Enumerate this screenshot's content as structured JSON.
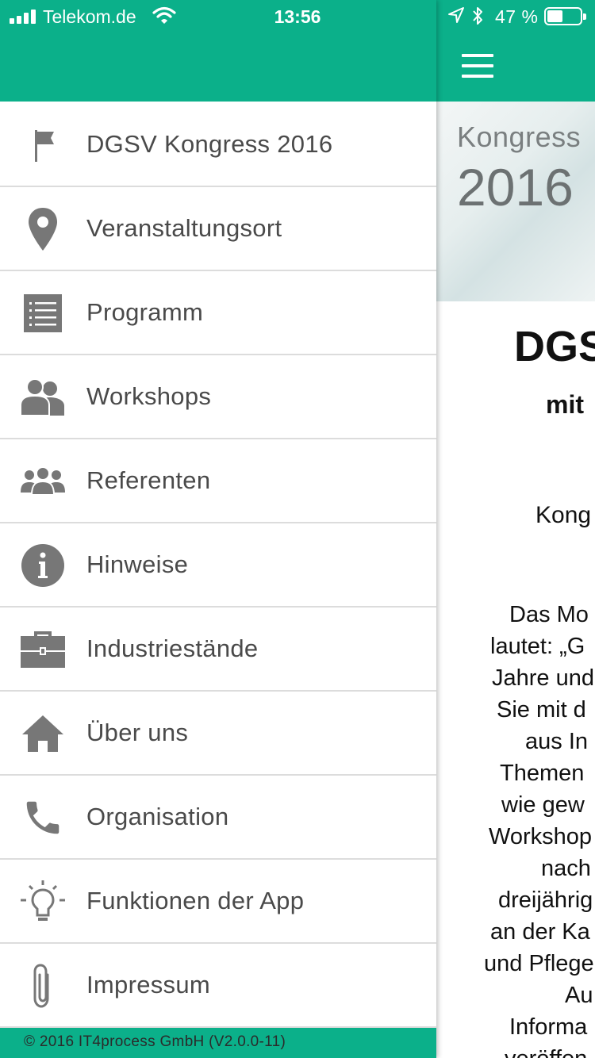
{
  "status_bar": {
    "carrier": "Telekom.de",
    "time": "13:56",
    "battery_percent": "47 %",
    "battery_level": 0.47
  },
  "colors": {
    "brand": "#0bb08a",
    "menu_text": "#4a4a4a",
    "icon": "#777777"
  },
  "drawer": {
    "items": [
      {
        "label": "DGSV Kongress 2016",
        "icon": "flag-icon"
      },
      {
        "label": "Veranstaltungsort",
        "icon": "map-pin-icon"
      },
      {
        "label": "Programm",
        "icon": "list-icon"
      },
      {
        "label": "Workshops",
        "icon": "people-pair-icon"
      },
      {
        "label": "Referenten",
        "icon": "group-icon"
      },
      {
        "label": "Hinweise",
        "icon": "info-icon"
      },
      {
        "label": "Industriestände",
        "icon": "briefcase-icon"
      },
      {
        "label": "Über uns",
        "icon": "home-icon"
      },
      {
        "label": "Organisation",
        "icon": "phone-icon"
      },
      {
        "label": "Funktionen der App",
        "icon": "lightbulb-icon"
      },
      {
        "label": "Impressum",
        "icon": "paperclip-icon"
      }
    ],
    "footer": "© 2016 IT4process GmbH (V2.0.0-11)"
  },
  "content": {
    "banner_line1": "Kongress",
    "banner_line2": "2016",
    "heading": "DGS",
    "subheading": "mit",
    "kong_line": "Kong",
    "paragraph_lines": [
      "Das Mo",
      "lautet: „G",
      "Jahre und",
      "Sie mit d",
      "aus In",
      "Themen",
      "wie gew",
      "Workshop",
      "nach",
      "dreijährig",
      "an der Ka",
      "und Pflege",
      "Au",
      "Informa",
      "veröffen"
    ]
  }
}
